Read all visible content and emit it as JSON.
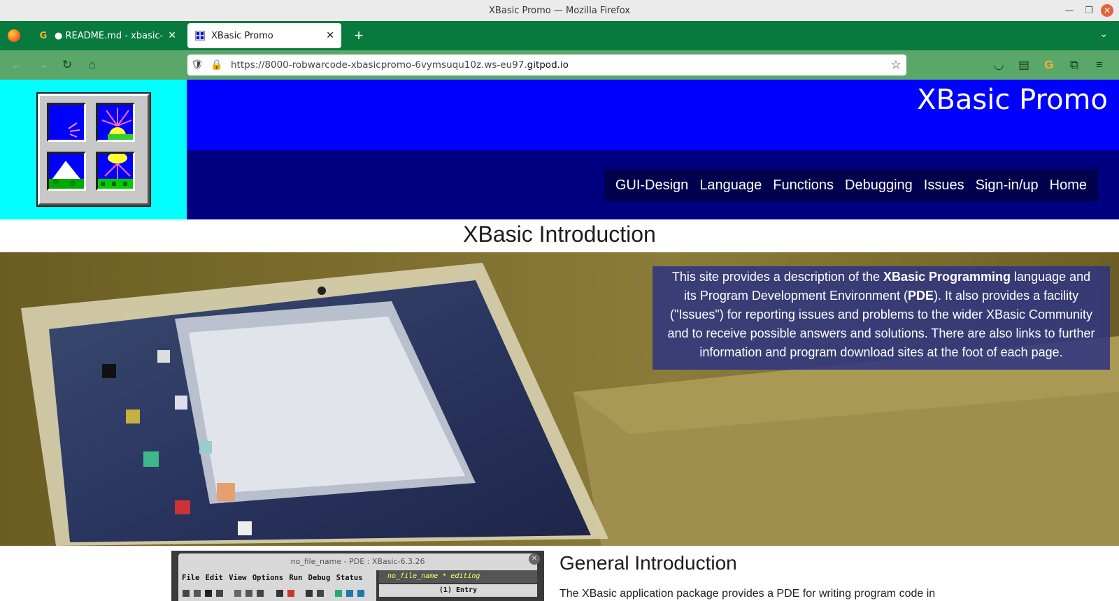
{
  "window": {
    "title": "XBasic Promo — Mozilla Firefox"
  },
  "tabs": [
    {
      "label": "● README.md - xbasic-pro",
      "icon": "gitpod-icon"
    },
    {
      "label": "XBasic Promo",
      "icon": "xbasic-favicon"
    }
  ],
  "url": {
    "prefix": "https://8000-robwarcode-xbasicpromo-6vymsuqu10z.ws-eu97.",
    "host": "gitpod.io"
  },
  "site": {
    "title": "XBasic Promo",
    "nav": [
      "GUI-Design",
      "Language",
      "Functions",
      "Debugging",
      "Issues",
      "Sign-in/up",
      "Home"
    ]
  },
  "intro": {
    "heading": "XBasic Introduction",
    "card": {
      "t1": "This site provides a description of the ",
      "b1": "XBasic Programming",
      "t2": " language and its Program Development Environment (",
      "b2": "PDE",
      "t3": "). It also provides a facility (\"Issues\") for reporting issues and problems to the wider XBasic Community and to receive possible answers and solutions. There are also links to further information and program download sites at the foot of each page."
    }
  },
  "pde_screenshot": {
    "title": "no_file_name - PDE : XBasic-6.3.26",
    "menu": "File Edit View Options Run Debug Status Help",
    "status": "no_file_name *      editing",
    "entry": "(1) Entry"
  },
  "general": {
    "heading": "General Introduction",
    "text": "The XBasic application package provides a PDE for writing program code in"
  },
  "colors": {
    "tabbar": "#087a3e",
    "navbar": "#5aa869",
    "logo_bg": "#00ffff",
    "banner_top": "#0000ff",
    "banner_bottom": "#000080",
    "nav_box": "#00004d",
    "hero_card": "#303480"
  }
}
